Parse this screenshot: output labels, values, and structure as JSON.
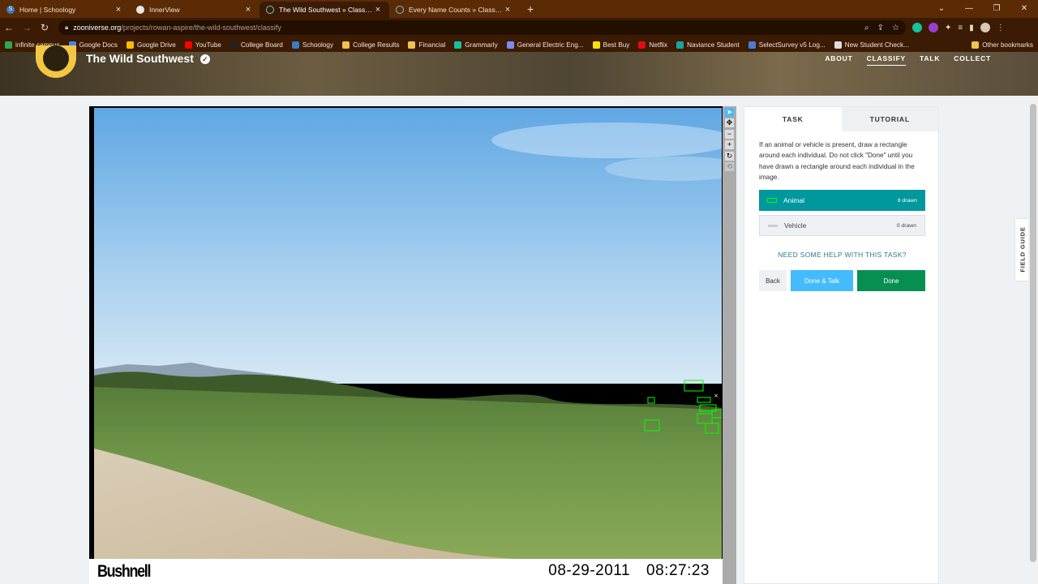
{
  "browser": {
    "tabs": [
      {
        "title": "Home | Schoology",
        "favicon": "schoology-icon",
        "active": false
      },
      {
        "title": "InnerView",
        "favicon": "innerview-icon",
        "active": false
      },
      {
        "title": "The Wild Southwest » Classify —",
        "favicon": "zooniverse-icon",
        "active": true
      },
      {
        "title": "Every Name Counts » Classify —",
        "favicon": "zooniverse-icon",
        "active": false
      }
    ],
    "url_domain": "zooniverse.org",
    "url_path": "/projects/rowan-aspire/the-wild-southwest/classify",
    "bookmarks": [
      {
        "label": "infinite campus",
        "color": "#2fa84f"
      },
      {
        "label": "Google Docs",
        "color": "#4285f4"
      },
      {
        "label": "Google Drive",
        "color": "#fbbc04"
      },
      {
        "label": "YouTube",
        "color": "#ff0000"
      },
      {
        "label": "College Board",
        "color": "#222222"
      },
      {
        "label": "Schoology",
        "color": "#3b7bbf"
      },
      {
        "label": "College Results",
        "color": "#f2c14e"
      },
      {
        "label": "Financial",
        "color": "#f2c14e"
      },
      {
        "label": "Grammarly",
        "color": "#15c39a"
      },
      {
        "label": "General Electric Eng...",
        "color": "#7b8cf0"
      },
      {
        "label": "Best Buy",
        "color": "#ffe000"
      },
      {
        "label": "Netflix",
        "color": "#e50914"
      },
      {
        "label": "Naviance Student",
        "color": "#1aa3a3"
      },
      {
        "label": "SelectSurvey v5 Log...",
        "color": "#4a7bd0"
      },
      {
        "label": "New Student Check...",
        "color": "#dddddd"
      }
    ],
    "other_bookmarks": "Other bookmarks"
  },
  "site": {
    "title": "The Wild Southwest",
    "nav": [
      "ABOUT",
      "CLASSIFY",
      "TALK",
      "COLLECT"
    ],
    "active_nav": "CLASSIFY"
  },
  "subject": {
    "camera_brand": "Bushnell",
    "date": "08-29-2011",
    "time": "08:27:23"
  },
  "task_panel": {
    "tabs": [
      "TASK",
      "TUTORIAL"
    ],
    "instructions": "If an animal or vehicle is present, draw a rectangle around each individual. Do not click \"Done\" until you have drawn a rectangle around each individual in the image.",
    "choices": [
      {
        "label": "Animal",
        "count": "8 drawn",
        "selected": true
      },
      {
        "label": "Vehicle",
        "count": "0 drawn",
        "selected": false
      }
    ],
    "help_link": "NEED SOME HELP WITH THIS TASK?",
    "buttons": {
      "back": "Back",
      "done_talk": "Done & Talk",
      "done": "Done"
    }
  },
  "field_guide": "FIELD GUIDE",
  "colors": {
    "selected_choice": "#00979d",
    "done_talk": "#43bbfd",
    "done": "#078f52",
    "box_stroke": "#00ff00"
  }
}
